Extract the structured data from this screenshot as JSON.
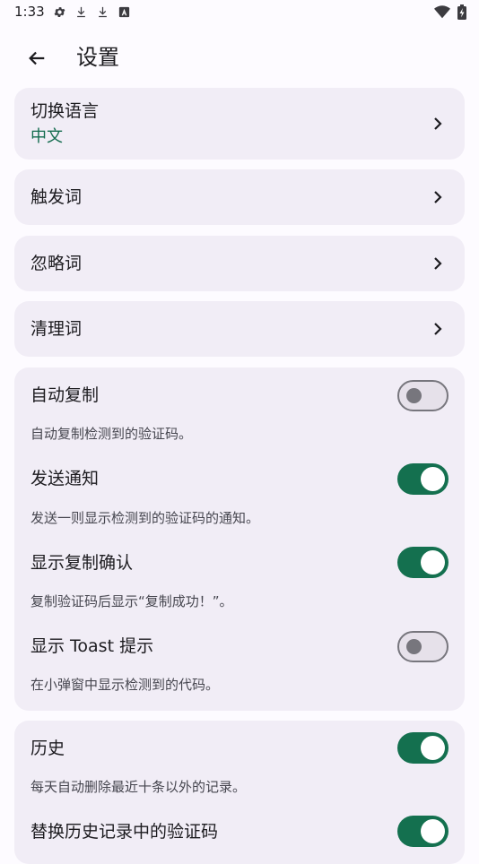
{
  "status_bar": {
    "time": "1:33",
    "icons": [
      "gear-icon",
      "download-icon",
      "download-icon",
      "notification-a-icon",
      "wifi-icon",
      "battery-charging-icon"
    ]
  },
  "app_bar": {
    "back_icon": "arrow-left-icon",
    "title": "设置"
  },
  "nav_items": [
    {
      "label": "切换语言",
      "value": "中文"
    },
    {
      "label": "触发词"
    },
    {
      "label": "忽略词"
    },
    {
      "label": "清理词"
    }
  ],
  "settings_group_1": [
    {
      "label": "自动复制",
      "description": "自动复制检测到的验证码。",
      "enabled": false
    },
    {
      "label": "发送通知",
      "description": "发送一则显示检测到的验证码的通知。",
      "enabled": true
    },
    {
      "label": "显示复制确认",
      "description": "复制验证码后显示“复制成功！”。",
      "enabled": true
    },
    {
      "label": "显示 Toast 提示",
      "description": "在小弹窗中显示检测到的代码。",
      "enabled": false
    }
  ],
  "settings_group_2": [
    {
      "label": "历史",
      "description": "每天自动删除最近十条以外的记录。",
      "enabled": true
    },
    {
      "label": "替换历史记录中的验证码",
      "enabled": true
    }
  ],
  "colors": {
    "accent": "#14704f",
    "value_text": "#146c4f",
    "card_background": "#f1edf6",
    "page_background": "#fdfbff"
  }
}
